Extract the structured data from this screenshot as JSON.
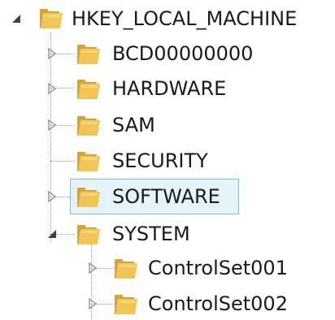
{
  "tree": {
    "root": {
      "label": "HKEY_LOCAL_MACHINE",
      "icon": "folder-icon",
      "expanded": true
    },
    "items": [
      {
        "label": "BCD00000000",
        "icon": "folder-icon",
        "expander": "collapsed"
      },
      {
        "label": "HARDWARE",
        "icon": "folder-icon",
        "expander": "collapsed"
      },
      {
        "label": "SAM",
        "icon": "folder-icon",
        "expander": "collapsed"
      },
      {
        "label": "SECURITY",
        "icon": "folder-icon",
        "expander": "none"
      },
      {
        "label": "SOFTWARE",
        "icon": "folder-icon",
        "expander": "collapsed",
        "selected": true
      },
      {
        "label": "SYSTEM",
        "icon": "folder-icon",
        "expander": "expanded"
      }
    ],
    "system_children": [
      {
        "label": "ControlSet001",
        "icon": "folder-icon",
        "expander": "collapsed"
      },
      {
        "label": "ControlSet002",
        "icon": "folder-icon",
        "expander": "collapsed"
      }
    ]
  },
  "colors": {
    "folder_body": "#e8b84a",
    "folder_tab": "#d9a233",
    "folder_inner": "#f7d77f",
    "selection_fill": "#e5f3fb",
    "selection_border": "#7fbde6",
    "tree_lines": "#a0a0a0",
    "expander_arrow": "#808080"
  }
}
